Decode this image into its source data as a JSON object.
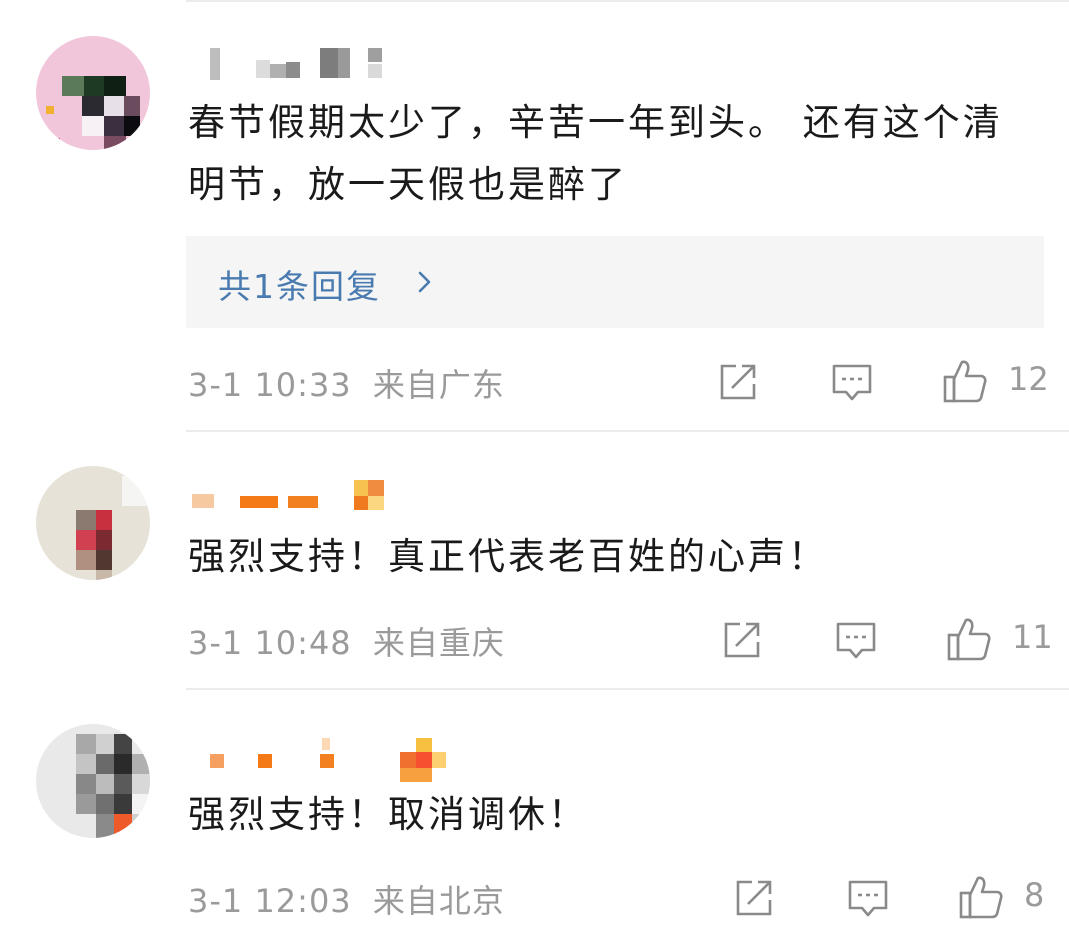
{
  "comments": [
    {
      "text": "春节假期太少了，辛苦一年到头。 还有这个清明节，放一天假也是醉了",
      "reply_link": "共1条回复",
      "time": "3-1 10:33",
      "location": "来自广东",
      "likes": "12"
    },
    {
      "text": "强烈支持！真正代表老百姓的心声！",
      "time": "3-1 10:48",
      "location": "来自重庆",
      "likes": "11"
    },
    {
      "text": "强烈支持！取消调休！",
      "time": "3-1 12:03",
      "location": "来自北京",
      "likes": "8"
    }
  ],
  "colors": {
    "reply_link": "#4a7bb0",
    "meta_text": "#9a9a9a",
    "body_text": "#1a1a1a",
    "reply_box_bg": "#f5f5f5"
  },
  "icons": [
    "share-icon",
    "comment-icon",
    "like-icon",
    "chevron-right-icon"
  ]
}
